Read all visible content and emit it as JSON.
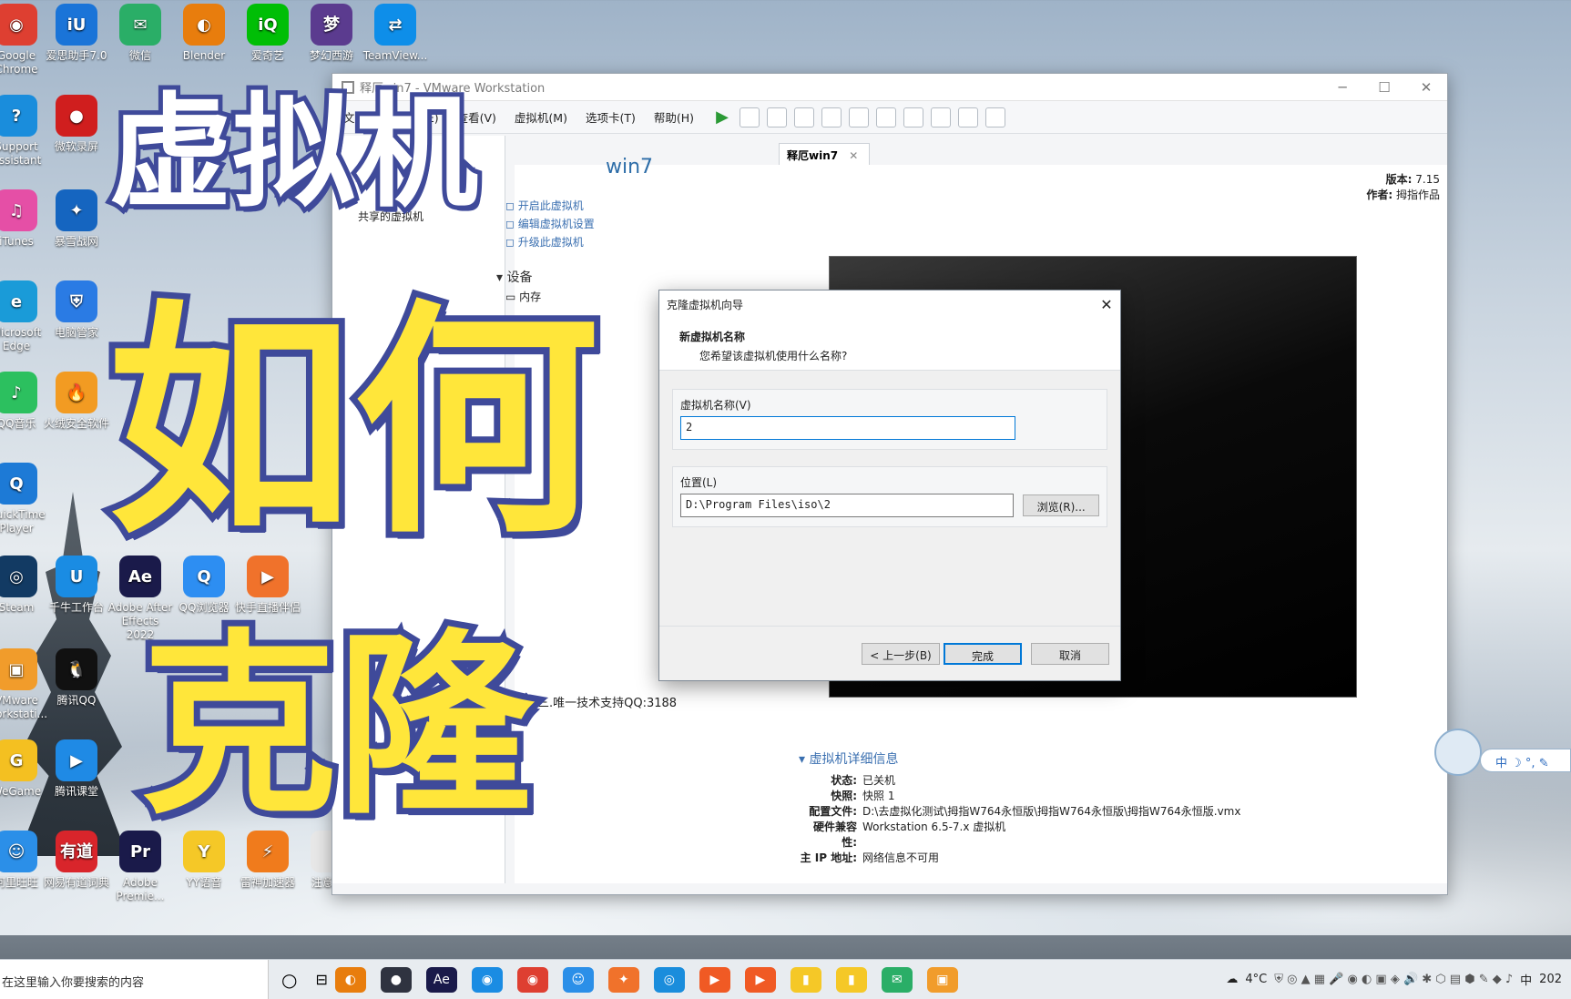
{
  "desktop_icons": [
    {
      "label": "Google Chrome",
      "color": "#de3f31",
      "glyph": "◉"
    },
    {
      "label": "爱思助手7.0",
      "color": "#1a74d8",
      "glyph": "iU"
    },
    {
      "label": "微信",
      "color": "#2aae67",
      "glyph": "✉"
    },
    {
      "label": "Blender",
      "color": "#e87d0d",
      "glyph": "◐"
    },
    {
      "label": "爱奇艺",
      "color": "#00be06",
      "glyph": "iQ"
    },
    {
      "label": "梦幻西游",
      "color": "#5b3b8f",
      "glyph": "梦"
    },
    {
      "label": "TeamView...",
      "color": "#0e8ee9",
      "glyph": "⇄"
    },
    {
      "label": "Support Assistant",
      "color": "#1a8ddc",
      "glyph": "?"
    },
    {
      "label": "微软录屏",
      "color": "#d01e1e",
      "glyph": "●"
    },
    {
      "label": "iTunes",
      "color": "#e54fa6",
      "glyph": "♫"
    },
    {
      "label": "暴雪战网",
      "color": "#1565c0",
      "glyph": "✦"
    },
    {
      "label": "Microsoft Edge",
      "color": "#1a9bd8",
      "glyph": "e"
    },
    {
      "label": "电脑管家",
      "color": "#2a7be4",
      "glyph": "⛨"
    },
    {
      "label": "QQ音乐",
      "color": "#2cc05f",
      "glyph": "♪"
    },
    {
      "label": "火绒安全软件",
      "color": "#f29b22",
      "glyph": "🔥"
    },
    {
      "label": "QuickTime Player",
      "color": "#1d7ad6",
      "glyph": "Q"
    },
    {
      "label": "Steam",
      "color": "#123a63",
      "glyph": "◎"
    },
    {
      "label": "千牛工作台",
      "color": "#1a8ce3",
      "glyph": "U"
    },
    {
      "label": "Adobe After Effects 2022",
      "color": "#1a1a4a",
      "glyph": "Ae"
    },
    {
      "label": "QQ浏览器",
      "color": "#2d8ef2",
      "glyph": "Q"
    },
    {
      "label": "快手直播伴侣",
      "color": "#f0722b",
      "glyph": "▶"
    },
    {
      "label": "VMware Workstati...",
      "color": "#f19c2b",
      "glyph": "▣"
    },
    {
      "label": "腾讯QQ",
      "color": "#111111",
      "glyph": "🐧"
    },
    {
      "label": "WeGame",
      "color": "#f4c021",
      "glyph": "G"
    },
    {
      "label": "腾讯课堂",
      "color": "#1f8ae5",
      "glyph": "▶"
    },
    {
      "label": "阿里旺旺",
      "color": "#2b8fe8",
      "glyph": "☺"
    },
    {
      "label": "网易有道词典",
      "color": "#d9252b",
      "glyph": "有道"
    },
    {
      "label": "Adobe Premie...",
      "color": "#1a1a4a",
      "glyph": "Pr"
    },
    {
      "label": "YY语音",
      "color": "#f5c827",
      "glyph": "Y"
    },
    {
      "label": "雷神加速器",
      "color": "#f07b1c",
      "glyph": "⚡"
    },
    {
      "label": "注意.txt",
      "color": "#e8e8e8",
      "glyph": ""
    }
  ],
  "overlay": {
    "line1": "虚拟机",
    "line2": "如何",
    "line3": "克隆"
  },
  "window": {
    "title": "释厄win7 - VMware Workstation",
    "menus": [
      "文件(F)",
      "编辑(E)",
      "查看(V)",
      "虚拟机(M)",
      "选项卡(T)",
      "帮助(H)"
    ],
    "tab_label": "释厄win7",
    "vm_title": "win7",
    "version_label": "版本:",
    "version_value": "7.15",
    "author_label": "作者:",
    "author_value": "拇指作品",
    "left_item": "共享的虚拟机",
    "links": [
      "开启此虚拟机",
      "编辑虚拟机设置",
      "升级此虚拟机"
    ],
    "devices_header": "设备",
    "devices_item": "内存",
    "support_text": "三.唯一技术支持QQ:3188",
    "details": {
      "header": "虚拟机详细信息",
      "rows": [
        {
          "k": "状态:",
          "v": "已关机"
        },
        {
          "k": "快照:",
          "v": "快照 1"
        },
        {
          "k": "配置文件:",
          "v": "D:\\去虚拟化测试\\拇指W764永恒版\\拇指W764永恒版\\拇指W764永恒版.vmx"
        },
        {
          "k": "硬件兼容性:",
          "v": "Workstation 6.5-7.x 虚拟机"
        },
        {
          "k": "主 IP 地址:",
          "v": "网络信息不可用"
        }
      ]
    }
  },
  "dialog": {
    "title": "克隆虚拟机向导",
    "heading": "新虚拟机名称",
    "subheading": "您希望该虚拟机使用什么名称?",
    "name_label": "虚拟机名称(V)",
    "name_value": "2",
    "location_label": "位置(L)",
    "location_value": "D:\\Program Files\\iso\\2",
    "browse_label": "浏览(R)...",
    "back_label": "< 上一步(B)",
    "finish_label": "完成",
    "cancel_label": "取消"
  },
  "taskbar": {
    "search_placeholder": "在这里输入你要搜索的内容",
    "weather": "4°C",
    "ime_label": "中",
    "clock_year": "202"
  },
  "colors": {
    "accent": "#0078d7",
    "overlay_fill": "#ffe63a",
    "overlay_stroke": "#3f4a9a"
  }
}
